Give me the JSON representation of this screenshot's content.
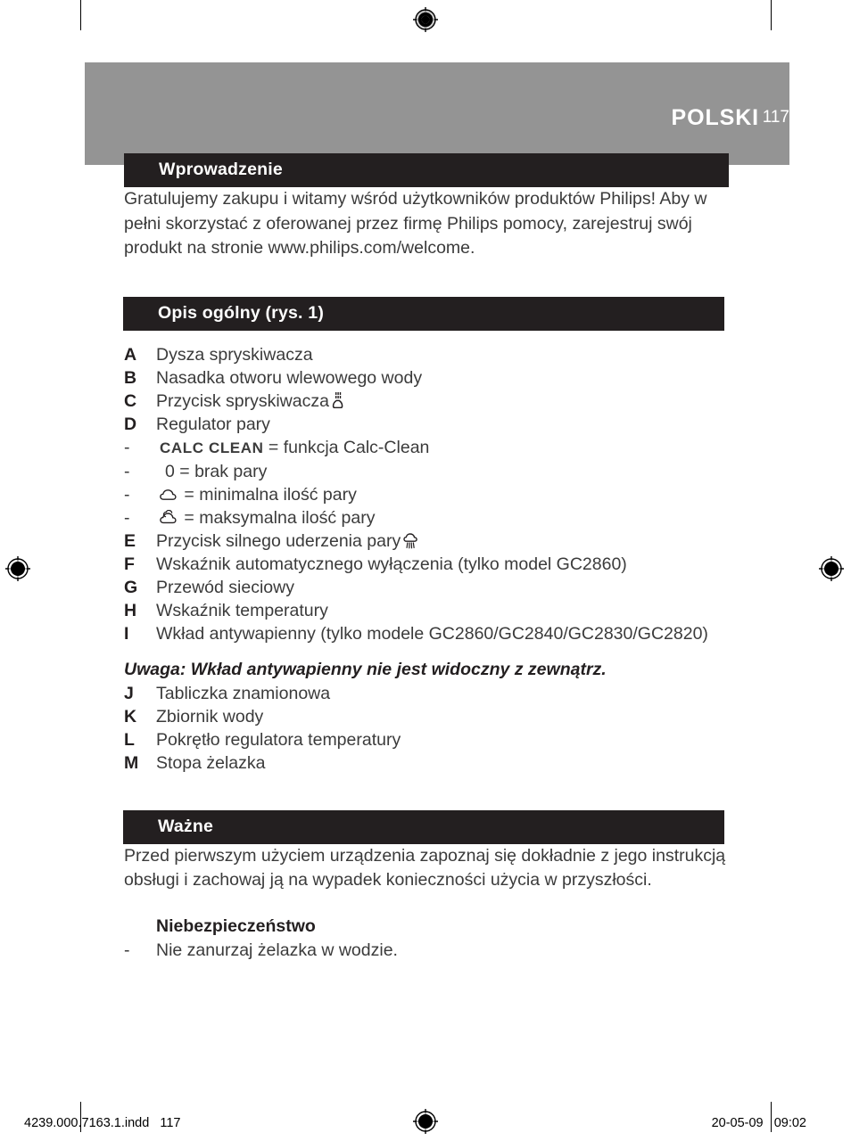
{
  "header": {
    "title": "POLSKI",
    "page_number": "117"
  },
  "sections": {
    "intro": {
      "heading": "Wprowadzenie",
      "paragraph": "Gratulujemy zakupu i witamy wśród użytkowników produktów Philips! Aby w pełni skorzystać z oferowanej przez firmę Philips pomocy, zarejestruj swój produkt na stronie www.philips.com/welcome."
    },
    "overview": {
      "heading": "Opis ogólny (rys. 1)",
      "items": [
        {
          "key": "A",
          "text": "Dysza spryskiwacza",
          "icon": ""
        },
        {
          "key": "B",
          "text": "Nasadka otworu wlewowego wody",
          "icon": ""
        },
        {
          "key": "C",
          "text": "Przycisk spryskiwacza",
          "icon": "spray-icon"
        },
        {
          "key": "D",
          "text": "Regulator pary",
          "icon": ""
        }
      ],
      "steam_settings": [
        {
          "key": "-",
          "bold": "CALC CLEAN",
          "text": " = funkcja Calc-Clean",
          "icon": ""
        },
        {
          "key": "-",
          "bold": "",
          "text": "0 = brak pary",
          "icon": ""
        },
        {
          "key": "-",
          "bold": "",
          "text": " = minimalna ilość pary",
          "icon": "steam-min-icon"
        },
        {
          "key": "-",
          "bold": "",
          "text": " = maksymalna ilość pary",
          "icon": "steam-max-icon"
        }
      ],
      "items_cont": [
        {
          "key": "E",
          "text": "Przycisk silnego uderzenia pary",
          "icon": "steam-shot-icon"
        },
        {
          "key": "F",
          "text": "Wskaźnik automatycznego wyłączenia (tylko model GC2860)",
          "icon": ""
        },
        {
          "key": "G",
          "text": "Przewód sieciowy",
          "icon": ""
        },
        {
          "key": "H",
          "text": "Wskaźnik temperatury",
          "icon": ""
        },
        {
          "key": "I",
          "text": "Wkład antywapienny (tylko modele GC2860/GC2840/GC2830/GC2820)",
          "icon": ""
        }
      ],
      "note": "Uwaga: Wkład antywapienny nie jest widoczny z zewnątrz.",
      "items_final": [
        {
          "key": "J",
          "text": "Tabliczka znamionowa",
          "icon": ""
        },
        {
          "key": "K",
          "text": "Zbiornik wody",
          "icon": ""
        },
        {
          "key": "L",
          "text": "Pokrętło regulatora temperatury",
          "icon": ""
        },
        {
          "key": "M",
          "text": "Stopa żelazka",
          "icon": ""
        }
      ]
    },
    "important": {
      "heading": "Ważne",
      "paragraph": "Przed pierwszym użyciem urządzenia zapoznaj się dokładnie z jego instrukcją obsługi i zachowaj ją na wypadek konieczności użycia w przyszłości.",
      "subheading": "Niebezpieczeństwo",
      "bullets": [
        {
          "key": "-",
          "text": "Nie zanurzaj żelazka w wodzie."
        }
      ]
    }
  },
  "footer": {
    "left": "4239.000.7163.1.indd   117",
    "right": "20-05-09   09:02"
  },
  "colors": {
    "header_band": "#949494",
    "section_bar": "#231f20",
    "body_text": "#3b3b3b",
    "page_background": "#ffffff"
  }
}
